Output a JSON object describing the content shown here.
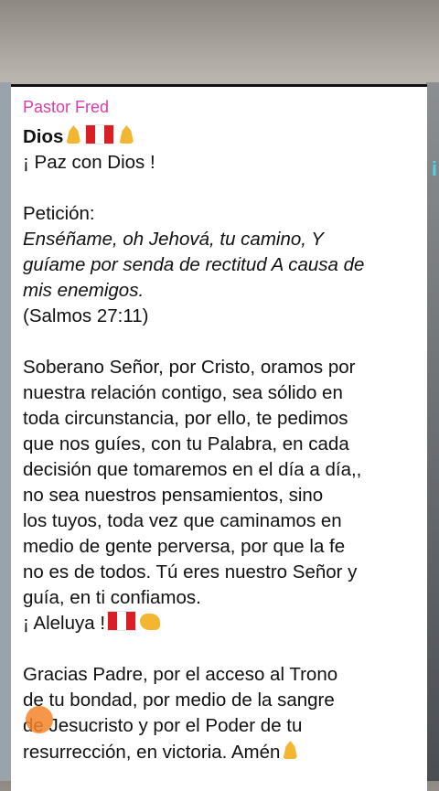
{
  "message": {
    "sender": "Pastor Fred",
    "title": "Dios",
    "greeting": "¡ Paz con Dios !",
    "petition_label": "Petición:",
    "verse_lines": [
      "Enséñame, oh Jehová, tu camino, Y",
      "guíame por senda de rectitud A causa de",
      "mis enemigos."
    ],
    "verse_ref": "(Salmos 27:11)",
    "prayer_lines": [
      "Soberano Señor, por Cristo, oramos por",
      "nuestra relación contigo, sea sólido en",
      "toda circunstancia, por ello, te pedimos",
      "que nos guíes, con tu Palabra, en cada",
      "decisión que tomaremos en el día a día,,",
      "no sea nuestros pensamientos, sino",
      "los tuyos, toda vez que caminamos en",
      "medio de gente perversa, por que la fe",
      "no es de todos.  Tú eres nuestro Señor y",
      "guía, en ti confiamos."
    ],
    "aleluya": "¡ Aleluya !",
    "closing_lines": [
      "Gracias Padre, por el acceso al Trono",
      "de tu bondad, por medio de la sangre",
      "de Jesucristo y por el Poder de tu",
      "resurrección, en victoria. Amén"
    ]
  },
  "icons": [
    "praying-hands-icon",
    "peru-flag-icon",
    "flexed-biceps-icon"
  ],
  "colors": {
    "sender": "#d43fa8",
    "bubble": "#ffffff"
  }
}
